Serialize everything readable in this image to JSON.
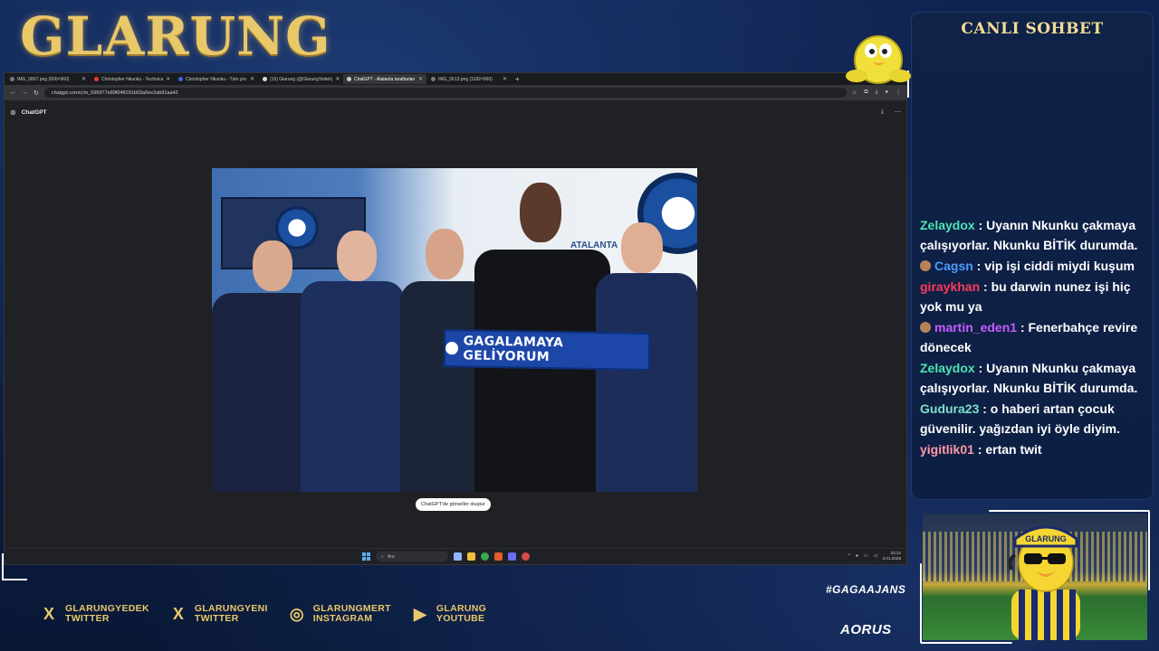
{
  "brand": {
    "logo_text": "GLARUNG"
  },
  "browser": {
    "tabs": [
      {
        "label": "IMG_0807.png (600×960)",
        "active": false
      },
      {
        "label": "Christopher Nkunku - Technica",
        "active": false
      },
      {
        "label": "Christopher Nkunku - Tüm pro",
        "active": false
      },
      {
        "label": "(16) Glarung (@GlarungYedek)",
        "active": false
      },
      {
        "label": "ChatGPT - Atalanta taraftarları",
        "active": true
      },
      {
        "label": "IMG_0613.png (1182×960)",
        "active": false
      }
    ],
    "new_tab": "+",
    "url": "chatgpt.com/c/m_695977e89f048191b53a0ee2ab91aa42",
    "app_name": "ChatGPT",
    "image_caption": "GAGALAMAYA GELİYORUM",
    "tooltip": "ChatGPT'de görseller oluştur",
    "wall_text": "ATALANTA",
    "taskbar": {
      "search_placeholder": "Ara",
      "time": "23:12",
      "date": "3.01.2026"
    }
  },
  "chat": {
    "title": "CANLI SOHBET",
    "messages": [
      {
        "user": "Zelaydox",
        "color": "#4fe3b4",
        "badge": false,
        "text": " : Uyanın Nkunku çakmaya çalışıyorlar. Nkunku BİTİK durumda."
      },
      {
        "user": "Cagsn",
        "color": "#4a9bff",
        "badge": true,
        "text": " : vip işi ciddi miydi kuşum"
      },
      {
        "user": "giraykhan",
        "color": "#ff3b5c",
        "badge": false,
        "text": " : bu darwin nunez işi hiç yok mu ya"
      },
      {
        "user": "martin_eden1",
        "color": "#c65cff",
        "badge": true,
        "text": " : Fenerbahçe revire dönecek"
      },
      {
        "user": "Zelaydox",
        "color": "#4fe3b4",
        "badge": false,
        "text": " : Uyanın Nkunku çakmaya çalışıyorlar. Nkunku BİTİK durumda."
      },
      {
        "user": "Gudura23",
        "color": "#7fe0c8",
        "badge": false,
        "text": " : o haberi artan çocuk güvenilir. yağızdan iyi öyle diyim."
      },
      {
        "user": "yigitlik01",
        "color": "#ff9aa8",
        "badge": false,
        "text": " : ertan twit"
      }
    ]
  },
  "socials": [
    {
      "icon": "x-icon",
      "glyph": "X",
      "name": "GLARUNGYEDEK",
      "platform": "TWITTER"
    },
    {
      "icon": "x-icon",
      "glyph": "X",
      "name": "GLARUNGYENI",
      "platform": "TWITTER"
    },
    {
      "icon": "instagram-icon",
      "glyph": "◎",
      "name": "GLARUNGMERT",
      "platform": "INSTAGRAM"
    },
    {
      "icon": "youtube-icon",
      "glyph": "▶",
      "name": "GLARUNG",
      "platform": "YOUTUBE"
    }
  ],
  "hashtag": "#GAGAAJANS",
  "sponsor": "AORUS",
  "cam": {
    "cap_text": "GLARUNG"
  }
}
